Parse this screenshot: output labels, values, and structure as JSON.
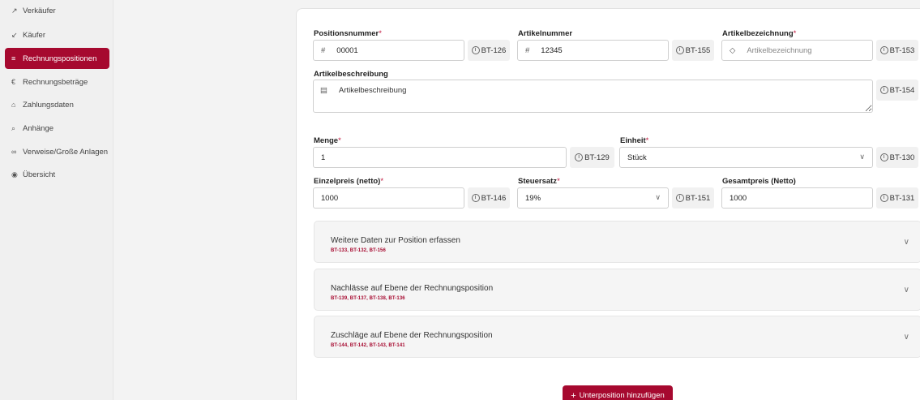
{
  "sidebar": {
    "items": [
      {
        "icon": "↗",
        "label": "Verkäufer"
      },
      {
        "icon": "↙",
        "label": "Käufer"
      },
      {
        "icon": "≡",
        "label": "Rechnungspositionen"
      },
      {
        "icon": "€",
        "label": "Rechnungsbeträge"
      },
      {
        "icon": "⌂",
        "label": "Zahlungsdaten"
      },
      {
        "icon": "⌕",
        "label": "Anhänge"
      },
      {
        "icon": "∞",
        "label": "Verweise/Große Anlagen"
      },
      {
        "icon": "◉",
        "label": "Übersicht"
      }
    ],
    "active_index": 2
  },
  "form": {
    "required_mark": "*",
    "info_glyph": "i",
    "hash": "#",
    "chevron": "∨",
    "tag_glyph": "◇",
    "text_glyph": "▤",
    "positionsnummer": {
      "label": "Positionsnummer",
      "value": "00001",
      "bt": "BT-126"
    },
    "artikelnummer": {
      "label": "Artikelnummer",
      "value": "12345",
      "bt": "BT-155"
    },
    "artikelbezeichnung": {
      "label": "Artikelbezeichnung",
      "placeholder": "Artikelbezeichnung",
      "bt": "BT-153"
    },
    "artikelbeschreibung": {
      "label": "Artikelbeschreibung",
      "value": "Artikelbeschreibung",
      "bt": "BT-154"
    },
    "menge": {
      "label": "Menge",
      "value": "1",
      "bt": "BT-129"
    },
    "einheit": {
      "label": "Einheit",
      "value": "Stück",
      "bt": "BT-130"
    },
    "einzelpreis": {
      "label": "Einzelpreis (netto)",
      "value": "1000",
      "bt": "BT-146"
    },
    "steuersatz": {
      "label": "Steuersatz",
      "value": "19%",
      "bt": "BT-151"
    },
    "gesamtpreis": {
      "label": "Gesamtpreis (Netto)",
      "value": "1000",
      "bt": "BT-131"
    }
  },
  "accordions": [
    {
      "title": "Weitere Daten zur Position erfassen",
      "codes": "BT-133, BT-132, BT-156"
    },
    {
      "title": "Nachlässe auf Ebene der Rechnungsposition",
      "codes": "BT-139, BT-137, BT-138, BT-136"
    },
    {
      "title": "Zuschläge auf Ebene der Rechnungsposition",
      "codes": "BT-144, BT-142, BT-143, BT-141"
    }
  ],
  "add_button": {
    "plus": "+",
    "label": "Unterposition hinzufügen"
  },
  "colors": {
    "accent": "#a6092f"
  }
}
